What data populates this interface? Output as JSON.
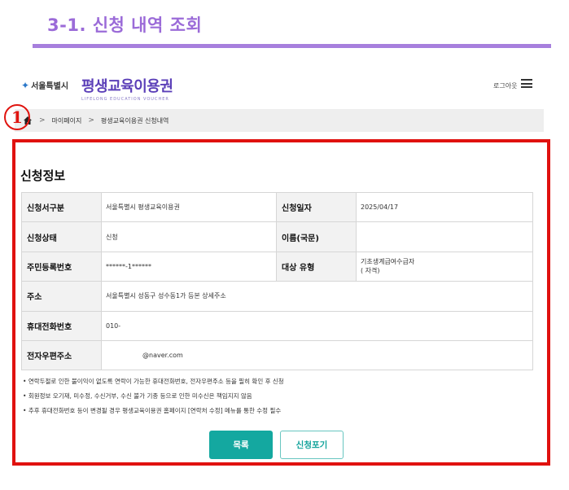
{
  "doc": {
    "title": "3-1. 신청 내역 조회"
  },
  "header": {
    "seoul_logo": "서울특별시",
    "brand": "평생교육이용권",
    "brand_sub": "LIFELONG EDUCATION VOUCHER",
    "login": "로그아웃",
    "menu_icon": "hamburger-icon"
  },
  "breadcrumb": {
    "home_icon": "home-icon",
    "items": [
      "마이페이지",
      "평생교육이용권 신청내역"
    ]
  },
  "annotation": {
    "number": "1"
  },
  "section": {
    "title": "신청정보"
  },
  "table": {
    "rows": [
      {
        "label": "신청서구분",
        "value": "서울특별시 평생교육이용권",
        "label2": "신청일자",
        "value2": "2025/04/17"
      },
      {
        "label": "신청상태",
        "value": "신청",
        "label2": "이름(국문)",
        "value2": ""
      },
      {
        "label": "주민등록번호",
        "value": "******-1******",
        "label2": "대상 유형",
        "value2_line1": "기초생계급여수급자",
        "value2_line2": "( 자격)"
      },
      {
        "label": "주소",
        "value": "서울특별시 성동구 성수동1가 등본 상세주소"
      },
      {
        "label": "휴대전화번호",
        "value": "010-"
      },
      {
        "label": "전자우편주소",
        "value": "@naver.com"
      }
    ]
  },
  "notes": [
    "연락두절로 인한 불이익이 없도록 연락이 가능한 휴대전화번호, 전자우편주소 등을 필히 확인 후 신청",
    "회원정보 오기재, 미수정, 수신거부, 수신 불가 기종 등으로 인한 미수신은 책임지지 않음",
    "추후 휴대전화번호 등이 변경될 경우 평생교육이용권 홈페이지 [연락처 수정] 메뉴를 통한 수정 필수"
  ],
  "buttons": {
    "list": "목록",
    "cancel": "신청포기"
  },
  "colors": {
    "accent": "#9b6bd8",
    "teal": "#14a8a0",
    "highlight": "#e0110f"
  }
}
